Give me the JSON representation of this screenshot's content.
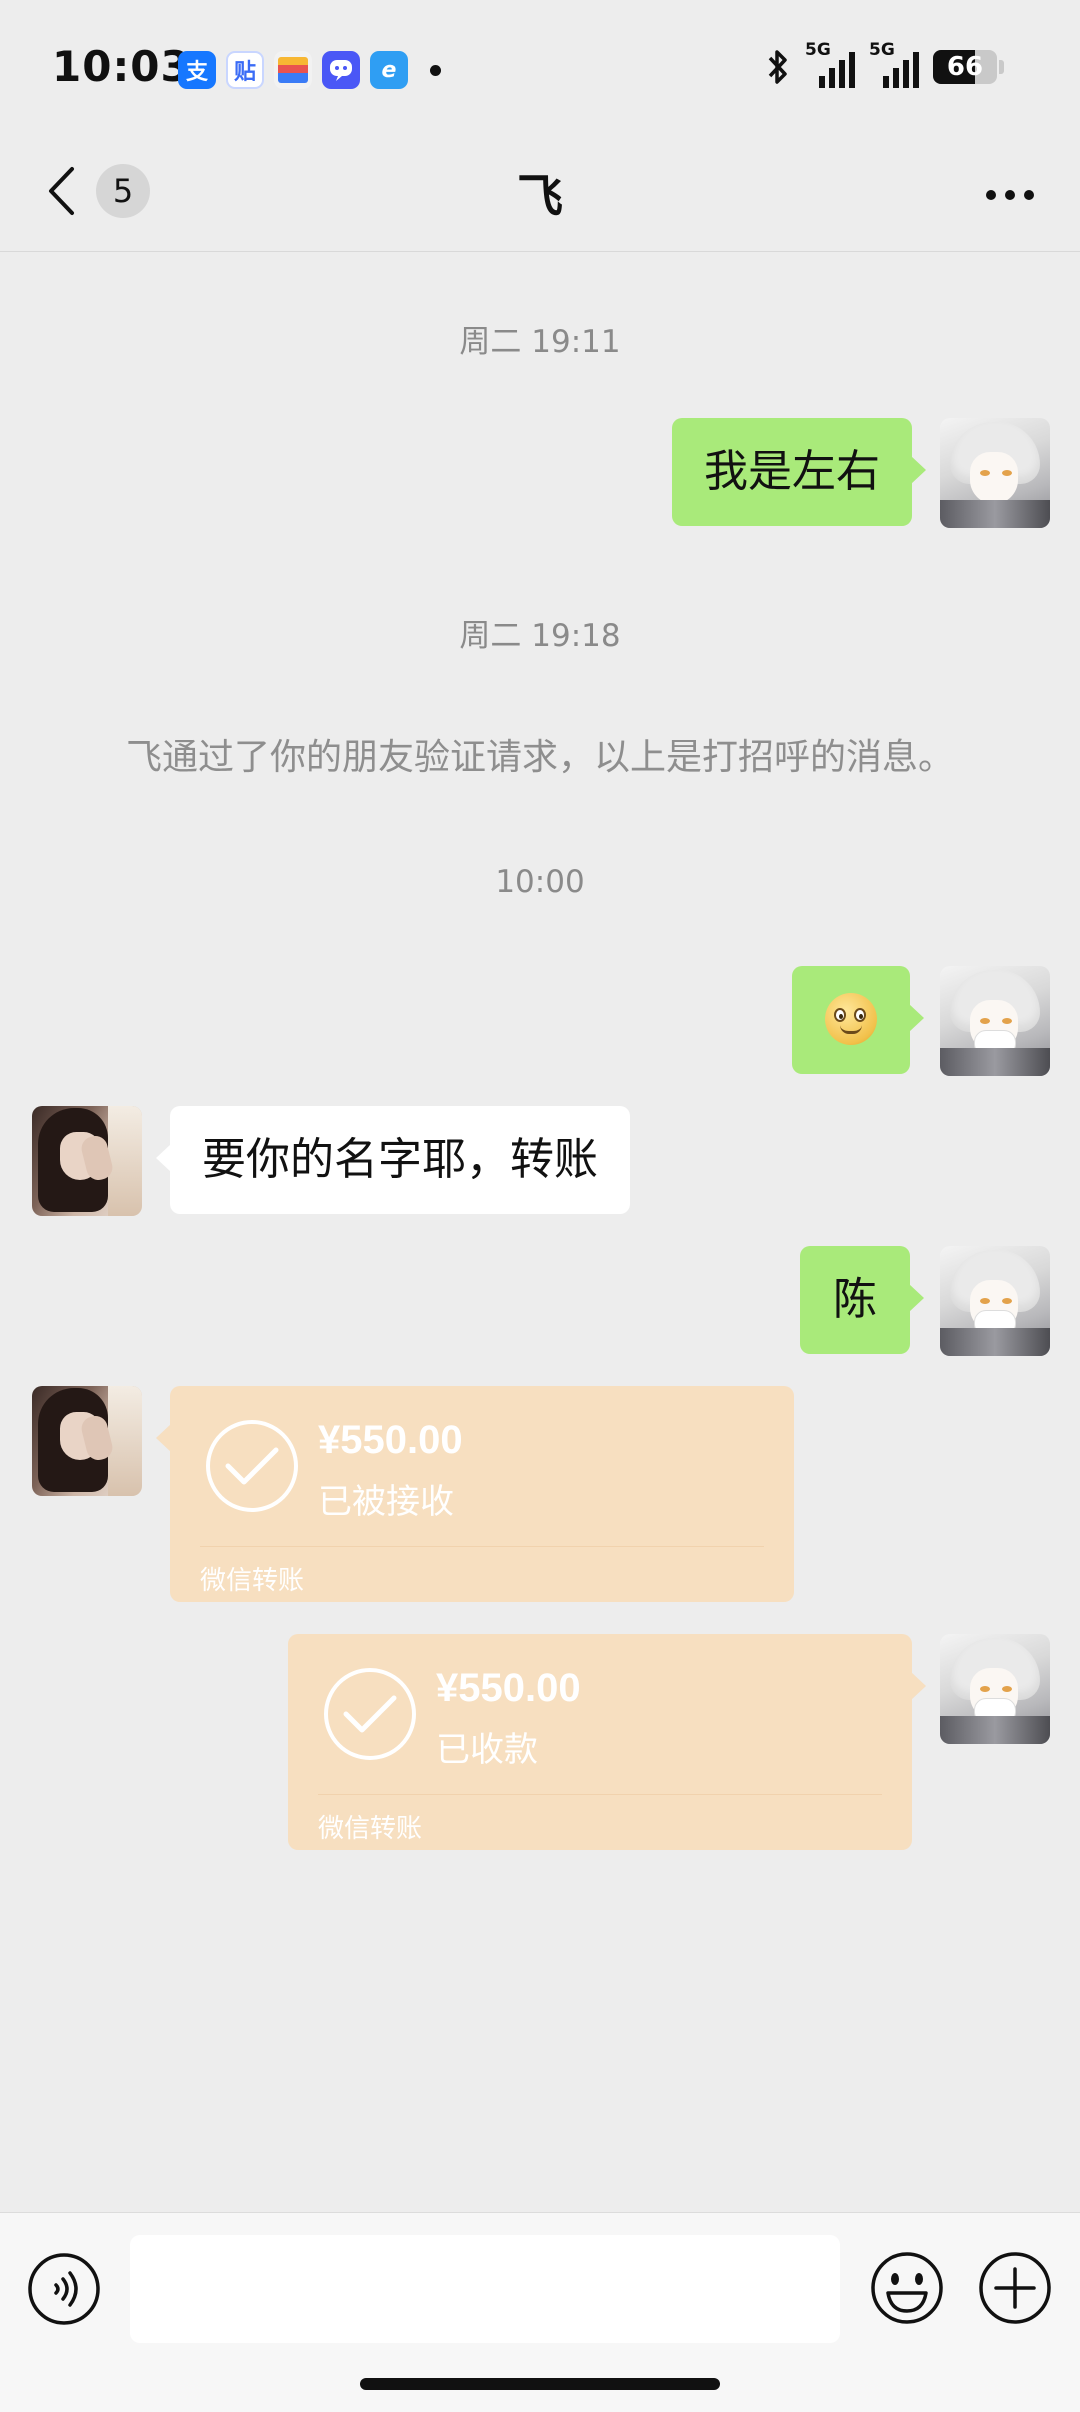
{
  "status_bar": {
    "time": "10:03",
    "apps": [
      {
        "icon": "alipay-icon",
        "glyph": "支",
        "color": "#1677ff"
      },
      {
        "icon": "tieba-icon",
        "glyph": "贴",
        "color": "#3b6cf6"
      },
      {
        "icon": "wallet-icon",
        "glyph": "",
        "color": "#f2f2f2"
      },
      {
        "icon": "chat-app-icon",
        "glyph": "",
        "color": "#4a57f6"
      },
      {
        "icon": "browser-app-icon",
        "glyph": "e",
        "color": "#2f9ef3"
      }
    ],
    "signal_1_label": "5G",
    "signal_2_label": "5G",
    "battery_text": "66",
    "battery_level": 0.66
  },
  "nav": {
    "unread_count": "5",
    "title": "飞"
  },
  "messages": {
    "ts1": "周二 19:11",
    "msg1": "我是左右",
    "ts2": "周二 19:18",
    "system_notice": "飞通过了你的朋友验证请求，以上是打招呼的消息。",
    "ts3": "10:00",
    "msg3": "要你的名字耶，转账",
    "msg4": "陈"
  },
  "transfers": [
    {
      "amount": "¥550.00",
      "status": "已被接收",
      "label": "微信转账"
    },
    {
      "amount": "¥550.00",
      "status": "已收款",
      "label": "微信转账"
    }
  ],
  "colors": {
    "outgoing_bubble": "#a9ea7a",
    "incoming_bubble": "#ffffff",
    "transfer_card": "#f7dfc0",
    "background": "#ededed"
  },
  "input": {
    "value": ""
  }
}
